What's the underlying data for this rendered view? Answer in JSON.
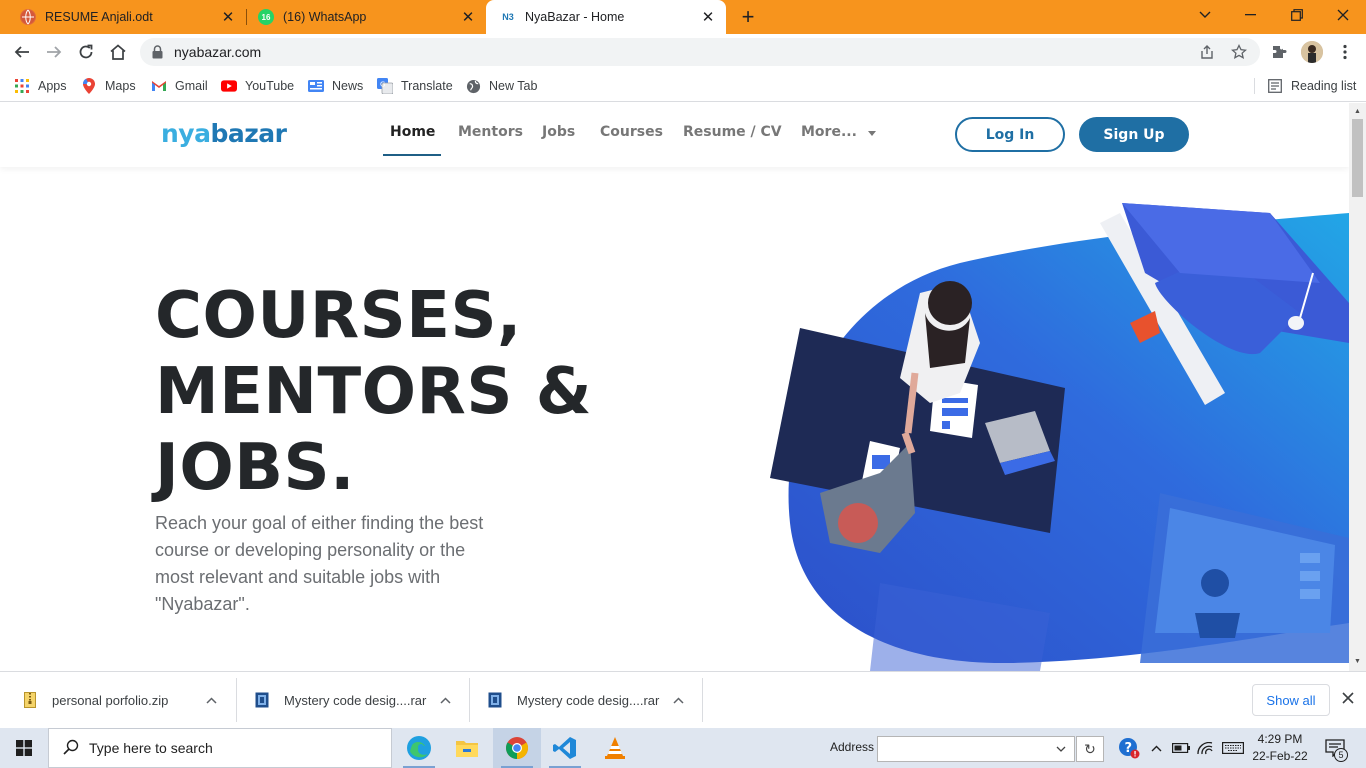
{
  "browser": {
    "tabs": [
      {
        "title": "RESUME Anjali.odt",
        "icon": "globe-icon"
      },
      {
        "title": "(16) WhatsApp",
        "icon": "whatsapp-icon",
        "badge": "16"
      },
      {
        "title": "NyaBazar - Home",
        "icon": "nyabazar-favicon",
        "active": true
      }
    ],
    "close_glyph": "✕",
    "new_tab_glyph": "+",
    "url": "nyabazar.com",
    "bookmarks": [
      {
        "label": "Apps",
        "icon": "apps-grid-icon"
      },
      {
        "label": "Maps",
        "icon": "maps-pin-icon"
      },
      {
        "label": "Gmail",
        "icon": "gmail-icon"
      },
      {
        "label": "YouTube",
        "icon": "youtube-icon"
      },
      {
        "label": "News",
        "icon": "news-icon"
      },
      {
        "label": "Translate",
        "icon": "translate-icon"
      },
      {
        "label": "New Tab",
        "icon": "globe-icon"
      }
    ],
    "reading_list": "Reading list",
    "accent": "#f7941d"
  },
  "site": {
    "logo": {
      "part1": "nya",
      "part2": "bazar"
    },
    "nav": [
      "Home",
      "Mentors",
      "Jobs",
      "Courses",
      "Resume / CV",
      "More..."
    ],
    "login": "Log In",
    "signup": "Sign Up",
    "hero_title": [
      "COURSES,",
      "MENTORS &",
      "JOBS."
    ],
    "hero_subtitle": "Reach your goal of either finding the best course or developing personality or the most relevant and suitable jobs with \"Nyabazar\".",
    "brand_color": "#1f6fa4"
  },
  "downloads": {
    "items": [
      {
        "name": "personal porfolio.zip",
        "icon": "zip-file-icon"
      },
      {
        "name": "Mystery code desig....rar",
        "icon": "rar-file-icon"
      },
      {
        "name": "Mystery code desig....rar",
        "icon": "rar-file-icon"
      }
    ],
    "show_all": "Show all"
  },
  "taskbar": {
    "search_placeholder": "Type here to search",
    "address_label": "Address",
    "time": "4:29 PM",
    "date": "22-Feb-22",
    "notifications": "5"
  }
}
